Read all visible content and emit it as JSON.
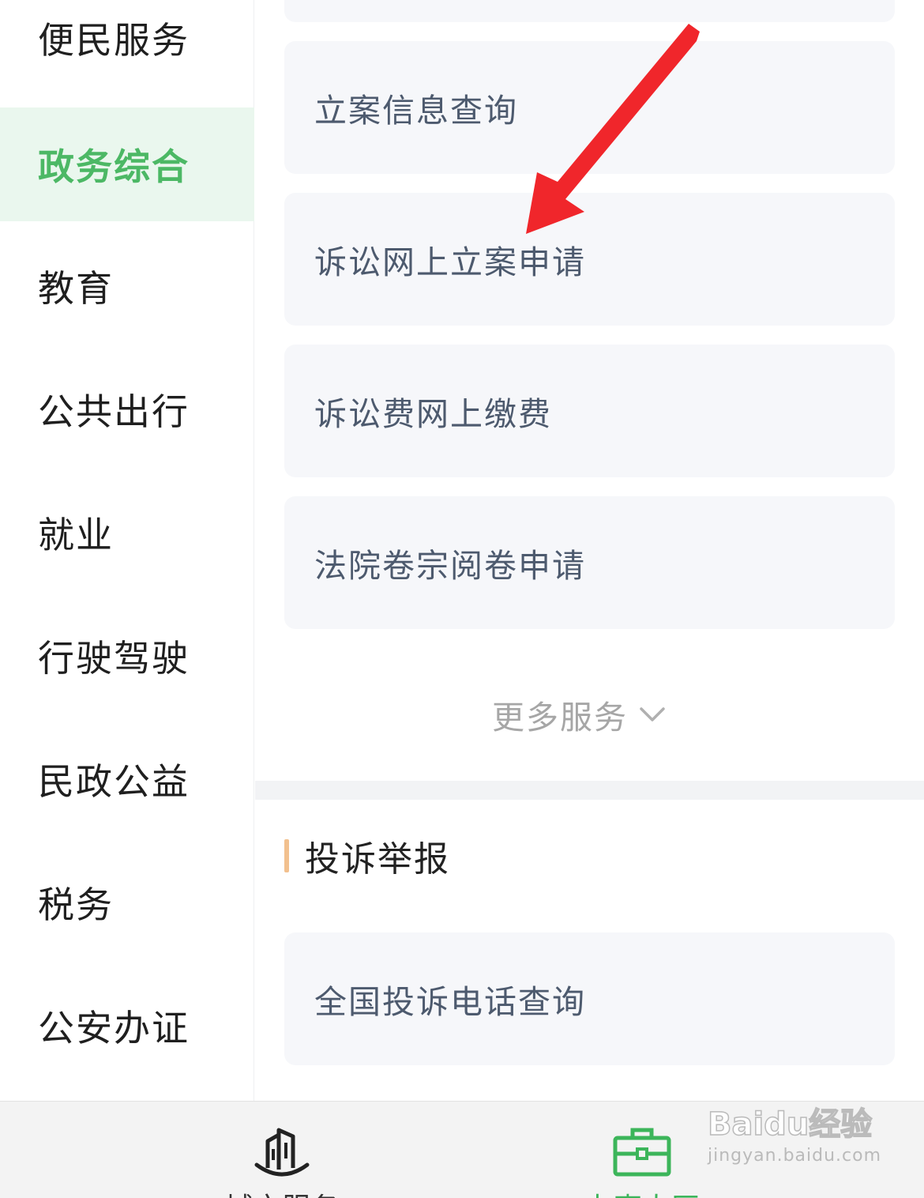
{
  "sidebar": {
    "items": [
      {
        "label": "便民服务"
      },
      {
        "label": "政务综合"
      },
      {
        "label": "教育"
      },
      {
        "label": "公共出行"
      },
      {
        "label": "就业"
      },
      {
        "label": "行驶驾驶"
      },
      {
        "label": "民政公益"
      },
      {
        "label": "税务"
      },
      {
        "label": "公安办证"
      }
    ],
    "active_index": 1
  },
  "main": {
    "services": [
      {
        "label": "立案信息查询"
      },
      {
        "label": "诉讼网上立案申请"
      },
      {
        "label": "诉讼费网上缴费"
      },
      {
        "label": "法院卷宗阅卷申请"
      }
    ],
    "more_label": "更多服务",
    "complaint_section": {
      "title": "投诉举报",
      "items": [
        {
          "label": "全国投诉电话查询"
        }
      ]
    }
  },
  "tabbar": {
    "tabs": [
      {
        "label": "城市服务",
        "icon": "building-icon"
      },
      {
        "label": "办事大厅",
        "icon": "briefcase-icon",
        "active": true
      }
    ]
  },
  "watermark": {
    "logo": "Baidu经验",
    "sub": "jingyan.baidu.com"
  },
  "colors": {
    "accent_green": "#4cb865",
    "active_bg": "#eaf7ee",
    "card_bg": "#f6f7fa",
    "annotation_red": "#f0262b",
    "section_bar": "#f2c08e"
  }
}
